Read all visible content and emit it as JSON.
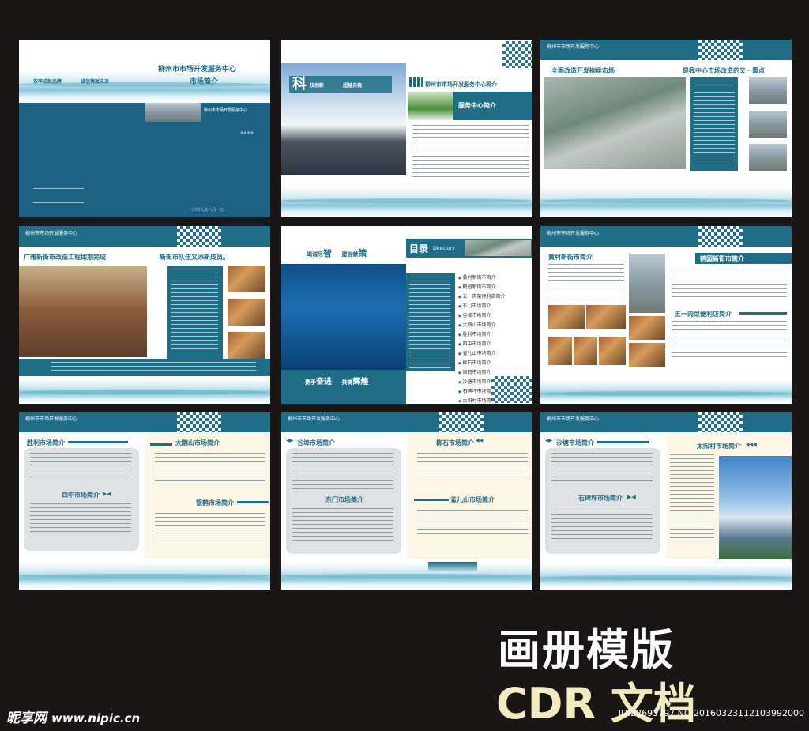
{
  "spreads": {
    "s1": {
      "header": "柳州市市场开发服务中心",
      "sub": "市场简介",
      "slogan1": "效率成就品牌",
      "slogan2": "诚信铸就未来",
      "org_small": "柳州市市场开发服务中心",
      "date": "二00九年六月一日"
    },
    "s2": {
      "banner_big": "科",
      "banner_a": "技创新",
      "banner_b": "超越自我",
      "title": "柳州市市场开发服务中心简介",
      "subtitle": "服务中心简介"
    },
    "s3": {
      "header": "柳州市市场开发服务中心",
      "t1": "全面改造开发柳侯市场",
      "t2": "是我中心市场改造的又一重点"
    },
    "s4": {
      "header": "柳州市市场开发服务中心",
      "t1": "广雅新街市改造工程如期完成",
      "t2": "新街市队伍又添新成员。"
    },
    "s5": {
      "slogan_top_a": "竭诚尽",
      "slogan_top_b": "智",
      "slogan_top_c": "建言献",
      "slogan_top_d": "策",
      "toc_title": "目录",
      "toc_en": "Directory",
      "slogan_bot_a": "携手",
      "slogan_bot_b": "奋进",
      "slogan_bot_c": "共铸",
      "slogan_bot_d": "辉煌",
      "toc": [
        "黄村新街市简介",
        "鹤园新街市简介",
        "五一肉菜便利店简介",
        "东门市场简介",
        "谷埠市场简介",
        "大鹅山市场简介",
        "胜利市场简介",
        "四中市场简介",
        "雀儿山市场简介",
        "柳石市场简介",
        "银鹤市场简介",
        "沙塘市场简介",
        "石碑坪市场简介",
        "太阳村市场简介"
      ]
    },
    "s6": {
      "header": "柳州市市场开发服务中心",
      "t1": "黄村新街市简介",
      "t2": "鹤园新街市简介",
      "t3": "五一肉菜便利店简介"
    },
    "s7": {
      "header": "柳州市市场开发服务中心",
      "t1": "胜利市场简介",
      "t2": "大鹅山市场简介",
      "t3": "四中市场简介",
      "t4": "银鹤市场简介"
    },
    "s8": {
      "header": "柳州市市场开发服务中心",
      "t1": "谷埠市场简介",
      "t2": "柳石市场简介",
      "t3": "东门市场简介",
      "t4": "雀儿山市场简介"
    },
    "s9": {
      "header": "柳州市市场开发服务中心",
      "t1": "沙塘市场简介",
      "t2": "太阳村市场简介",
      "t3": "石碑坪市场简介"
    }
  },
  "watermark": {
    "line1": "画册模版",
    "line2": "CDR 文档"
  },
  "site": {
    "brand": "昵享网",
    "url": "www.nipic.cn"
  },
  "stamp": "ID:22693797 NO:20160323112103992000",
  "colors": {
    "teal": "#1f6d86",
    "bg": "#1a1616",
    "cream": "#f2ebc0"
  }
}
